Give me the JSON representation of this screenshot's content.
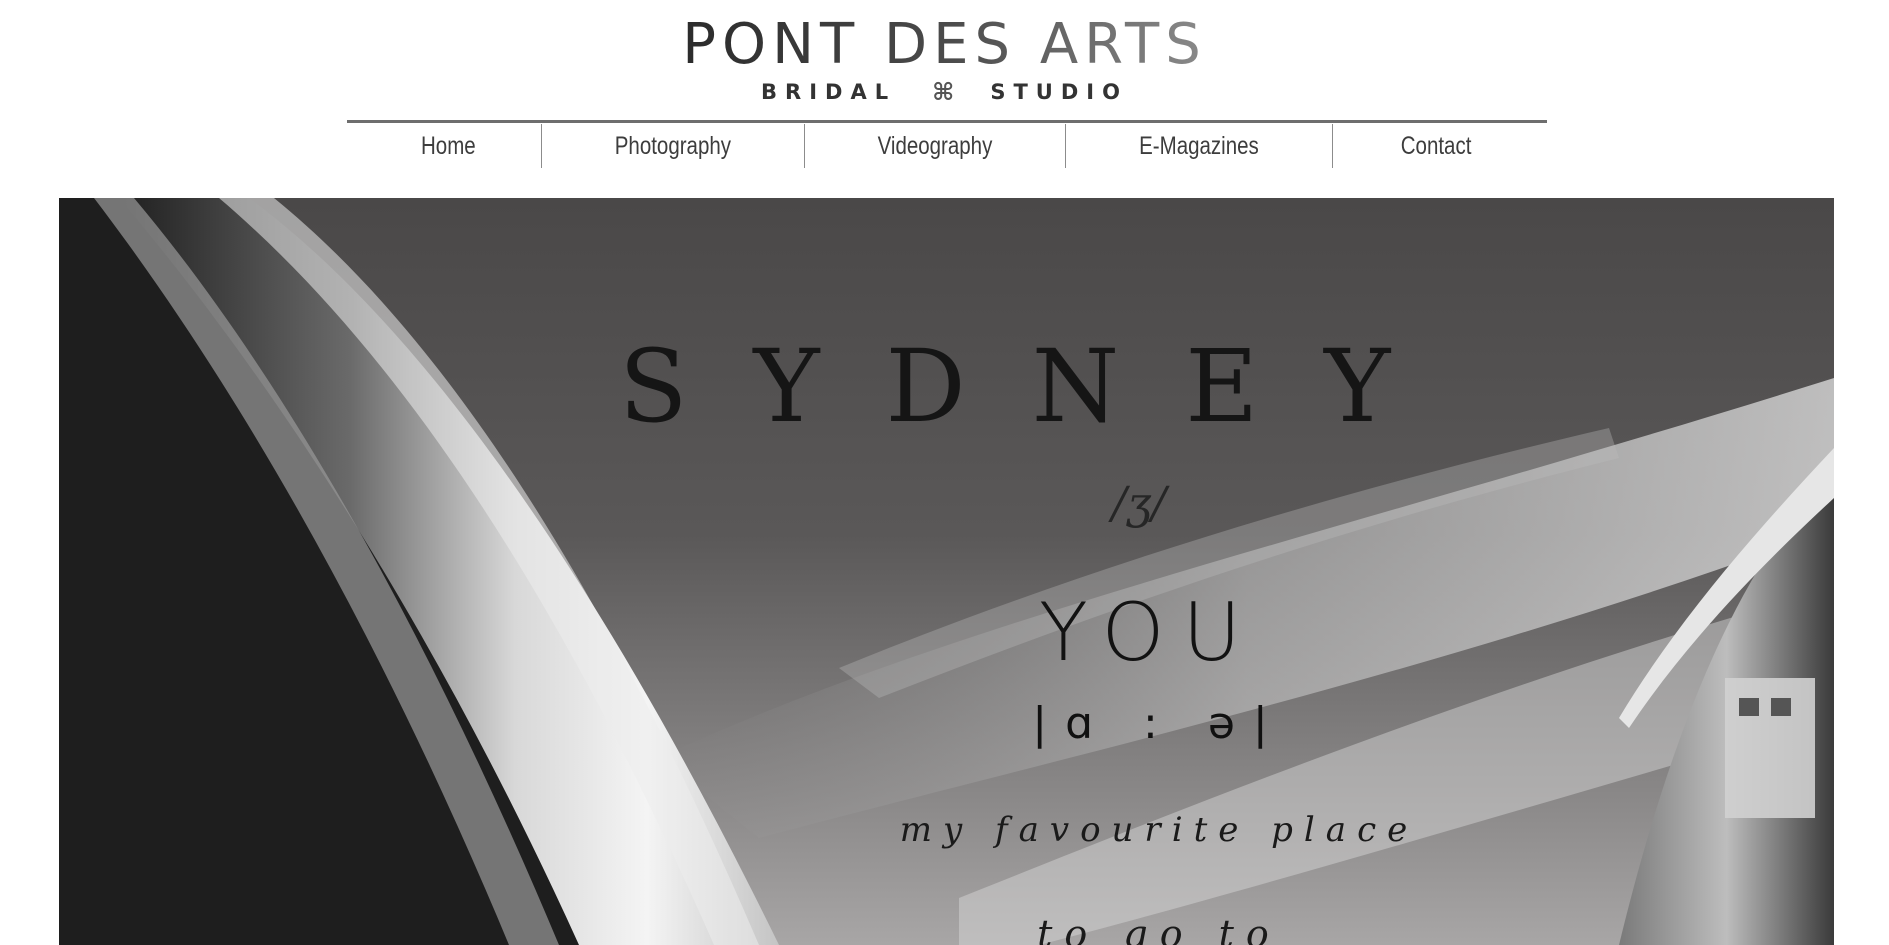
{
  "logo": {
    "title": "PONT DES ARTS",
    "subtitle_left": "BRIDAL",
    "subtitle_mark": "⌘",
    "subtitle_right": "STUDIO"
  },
  "nav": {
    "items": [
      {
        "label": "Home"
      },
      {
        "label": "Photography"
      },
      {
        "label": "Videography"
      },
      {
        "label": "E-Magazines"
      },
      {
        "label": "Contact"
      }
    ]
  },
  "hero": {
    "line1": "SYDNEY",
    "line2": "/ʒ/",
    "line3": "YOU",
    "line4": "|ɑ : ə|",
    "line5": "my favourite place",
    "line6": "to go to"
  },
  "colors": {
    "background": "#ffffff",
    "nav_text": "#3d3d3d",
    "divider": "#6e6e6e"
  }
}
